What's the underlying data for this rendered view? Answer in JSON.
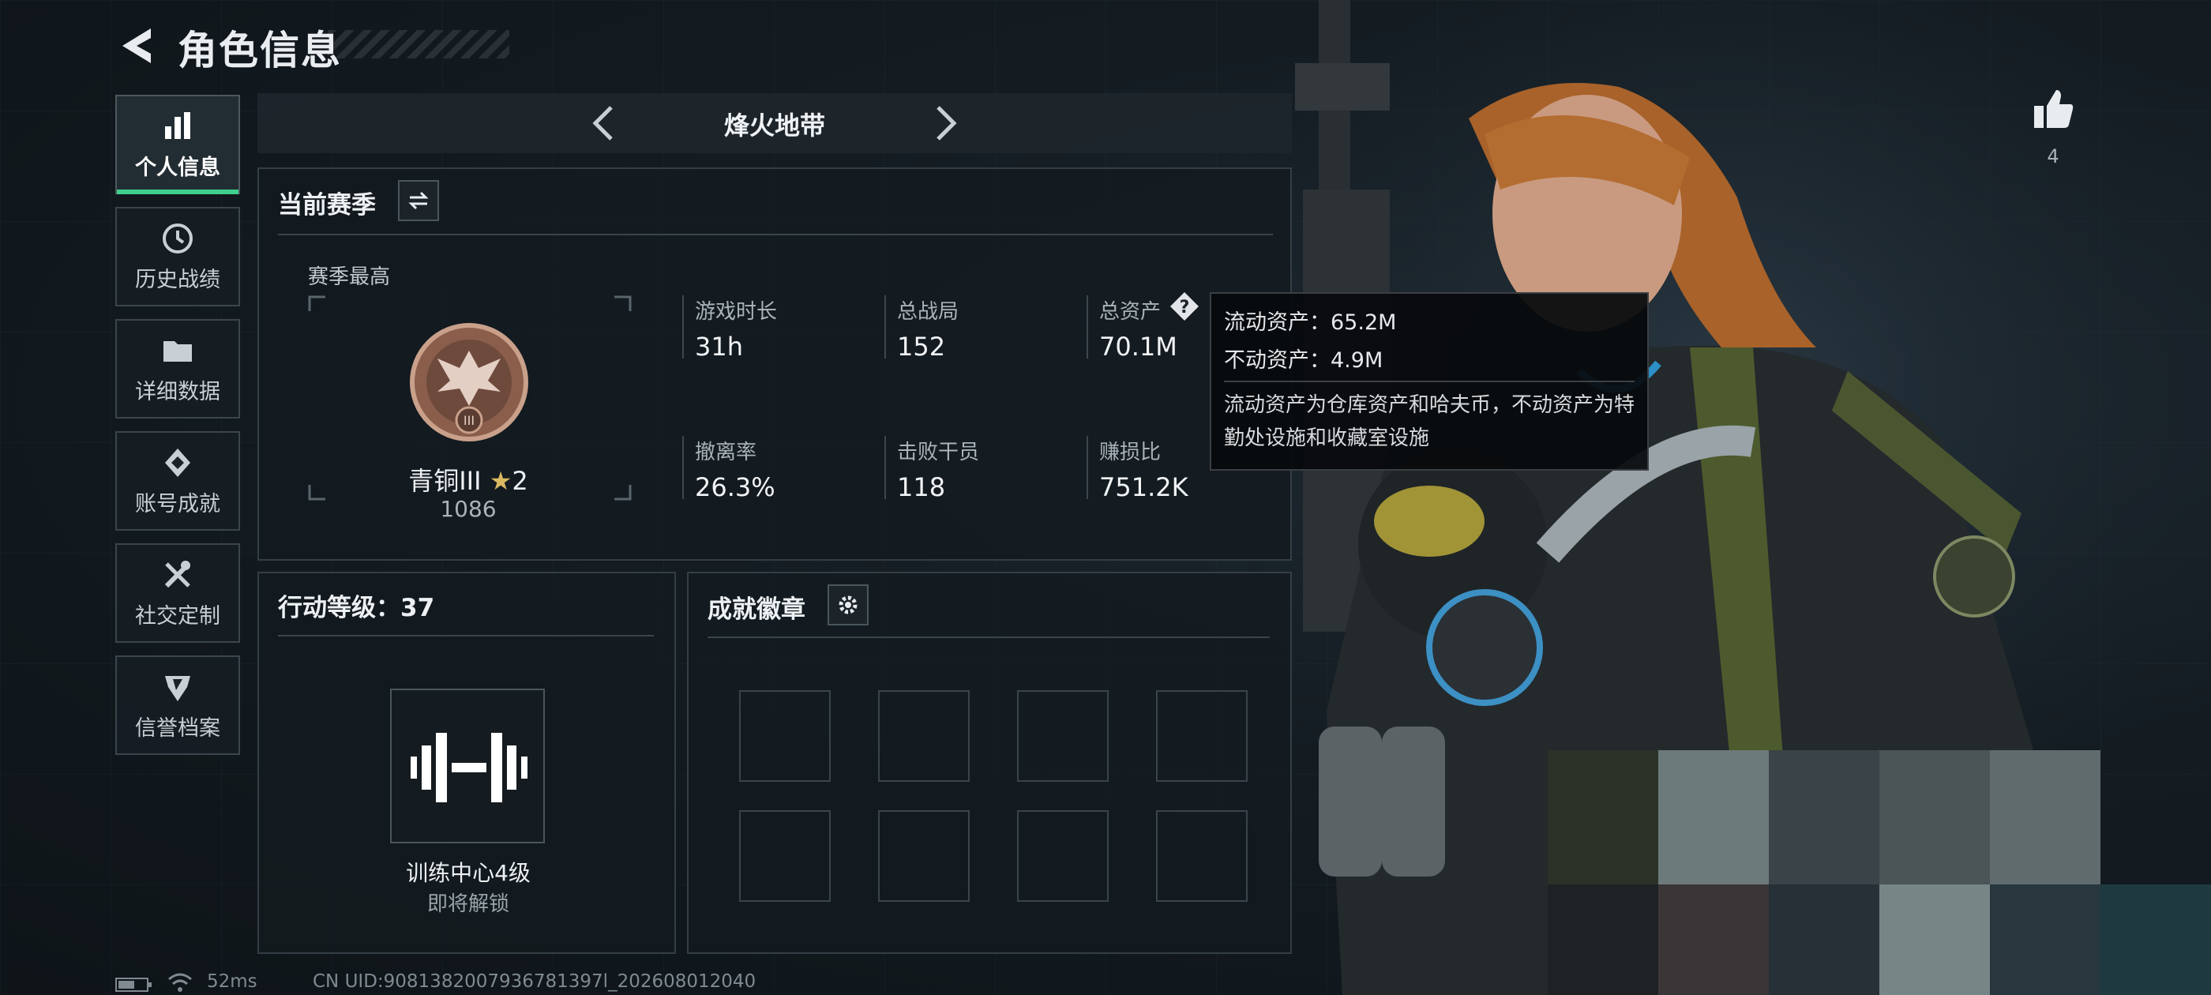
{
  "header": {
    "title": "角色信息"
  },
  "sidebar": {
    "items": [
      {
        "label": "个人信息",
        "icon": "bar-chart-icon",
        "active": true
      },
      {
        "label": "历史战绩",
        "icon": "history-icon",
        "active": false
      },
      {
        "label": "详细数据",
        "icon": "folder-icon",
        "active": false
      },
      {
        "label": "账号成就",
        "icon": "achievement-icon",
        "active": false
      },
      {
        "label": "社交定制",
        "icon": "tools-icon",
        "active": false
      },
      {
        "label": "信誉档案",
        "icon": "credit-icon",
        "active": false
      }
    ]
  },
  "mode_tabs": {
    "current": "烽火地带"
  },
  "season": {
    "title": "当前赛季",
    "best_label": "赛季最高",
    "rank_name": "青铜III",
    "rank_stars": "2",
    "rank_score": "1086",
    "stats": [
      {
        "label": "游戏时长",
        "value": "31h"
      },
      {
        "label": "总战局",
        "value": "152"
      },
      {
        "label": "总资产",
        "value": "70.1M"
      },
      {
        "label": "撤离率",
        "value": "26.3%"
      },
      {
        "label": "击败干员",
        "value": "118"
      },
      {
        "label": "赚损比",
        "value": "751.2K"
      }
    ]
  },
  "tooltip": {
    "liquid": "流动资产：65.2M",
    "fixed": "不动资产：4.9M",
    "description": "流动资产为仓库资产和哈夫币，不动资产为特勤处设施和收藏室设施"
  },
  "action_level": {
    "title": "行动等级：37",
    "unlock_name": "训练中心4级",
    "unlock_status": "即将解锁"
  },
  "badges": {
    "title": "成就徽章",
    "slot_count": 8
  },
  "likes": {
    "count": "4"
  },
  "footer": {
    "ping": "52ms",
    "uid": "CN UID:9081382007936781397l_202608012040"
  },
  "colors": {
    "accent": "#3fcf8e",
    "panel": "#141b20",
    "text": "#d9dee2"
  }
}
